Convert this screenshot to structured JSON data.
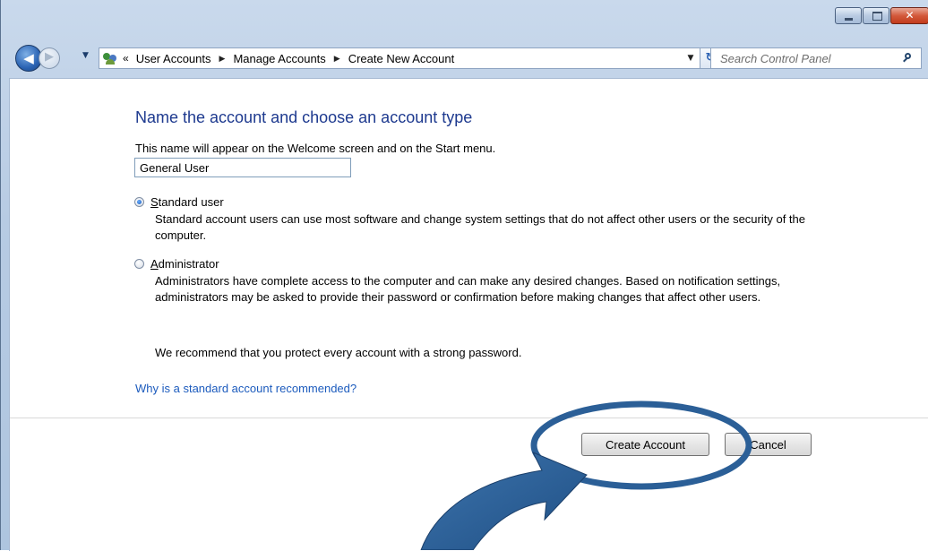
{
  "window": {
    "minimize_icon": "minimize-icon",
    "maximize_icon": "maximize-icon",
    "close_icon": "close-icon",
    "close_glyph": "✕"
  },
  "nav": {
    "back_glyph": "◀",
    "forward_glyph": "▶",
    "dropdown_glyph": "▼",
    "refresh_glyph": "↻"
  },
  "address": {
    "overflow": "«",
    "crumbs": [
      "User Accounts",
      "Manage Accounts",
      "Create New Account"
    ],
    "separator": "▶",
    "dropdown_glyph": "▼"
  },
  "search": {
    "placeholder": "Search Control Panel"
  },
  "form": {
    "title": "Name the account and choose an account type",
    "name_description": "This name will appear on the Welcome screen and on the Start menu.",
    "name_value": "General User",
    "standard": {
      "label_key": "S",
      "label_rest": "tandard user",
      "selected": true,
      "description": "Standard account users can use most software and change system settings that do not affect other users or the security of the computer."
    },
    "administrator": {
      "label_key": "A",
      "label_rest": "dministrator",
      "selected": false,
      "description": "Administrators have complete access to the computer and can make any desired changes. Based on notification settings, administrators may be asked to provide their password or confirmation before making changes that affect other users."
    },
    "recommendation": "We recommend that you protect every account with a strong password.",
    "why_link": "Why is a standard account recommended?"
  },
  "buttons": {
    "create": "Create Account",
    "cancel": "Cancel"
  },
  "colors": {
    "title_blue": "#1e3a8f",
    "link_blue": "#1c5bbd",
    "annotation_blue": "#2b5f97"
  }
}
